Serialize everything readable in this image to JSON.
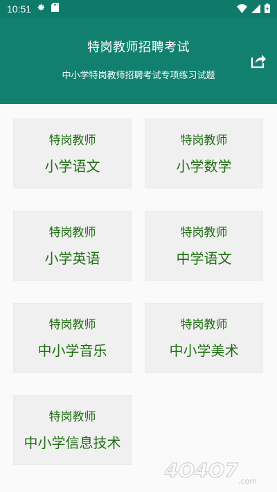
{
  "status_bar": {
    "time": "10:51",
    "icons": [
      "gear-icon",
      "sd-card-icon",
      "wifi-icon",
      "signal-icon",
      "battery-icon"
    ]
  },
  "header": {
    "title": "特岗教师招聘考试",
    "subtitle": "中小学特岗教师招聘考试专项练习试题",
    "share_icon": "share-icon"
  },
  "subjects": [
    {
      "top": "特岗教师",
      "main": "小学语文"
    },
    {
      "top": "特岗教师",
      "main": "小学数学"
    },
    {
      "top": "特岗教师",
      "main": "小学英语"
    },
    {
      "top": "特岗教师",
      "main": "中学语文"
    },
    {
      "top": "特岗教师",
      "main": "中小学音乐"
    },
    {
      "top": "特岗教师",
      "main": "中小学美术"
    },
    {
      "top": "特岗教师",
      "main": "中小学信息技术"
    }
  ],
  "colors": {
    "header_bg": "#12806f",
    "status_bg": "#0e7a6a",
    "card_bg": "#f0f0f0",
    "card_text": "#1f6f12"
  },
  "watermark": {
    "text": "4O4O7.com"
  }
}
